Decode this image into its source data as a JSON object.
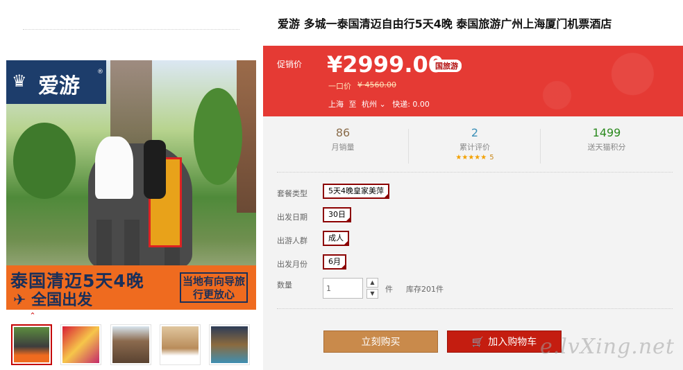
{
  "product": {
    "title": "爱游 多城一泰国清迈自由行5天4晚 泰国旅游广州上海厦门机票酒店"
  },
  "gallery": {
    "brand_name": "爱游",
    "brand_reg": "®",
    "banner_title": "泰国清迈5天4晚",
    "banner_sub": "全国出发",
    "banner_box": "当地有向导旅行更放心",
    "thumbnails": [
      {
        "icon": "thumb-elephant",
        "active": true
      },
      {
        "icon": "thumb-dancer",
        "active": false
      },
      {
        "icon": "thumb-temple",
        "active": false
      },
      {
        "icon": "thumb-hotel-room",
        "active": false
      },
      {
        "icon": "thumb-pool",
        "active": false
      }
    ]
  },
  "pricing": {
    "promo_label": "促销价",
    "price": "¥2999.00",
    "badge": "国旅游",
    "orig_label": "一口价",
    "orig_price": "¥ 4560.00",
    "from_city": "上海",
    "to_word": "至",
    "to_city": "杭州",
    "shipping": "快递: 0.00"
  },
  "stats": [
    {
      "value": "86",
      "label": "月销量",
      "color": "#8a6d4b"
    },
    {
      "value": "2",
      "label": "累计评价",
      "color": "#3a8fb7",
      "stars": "★★★★★",
      "rating": "5"
    },
    {
      "value": "1499",
      "label": "送天猫积分",
      "color": "#2b8a1e"
    }
  ],
  "options": {
    "package_label": "套餐类型",
    "package_value": "5天4晚皇家美萍",
    "date_label": "出发日期",
    "date_value": "30日",
    "group_label": "出游人群",
    "group_value": "成人",
    "month_label": "出发月份",
    "month_value": "6月",
    "qty_label": "数量",
    "qty_value": "1",
    "qty_unit": "件",
    "stock": "库存201件"
  },
  "actions": {
    "buy": "立刻购买",
    "cart": "加入购物车"
  },
  "watermark": "e.lvXing.net"
}
